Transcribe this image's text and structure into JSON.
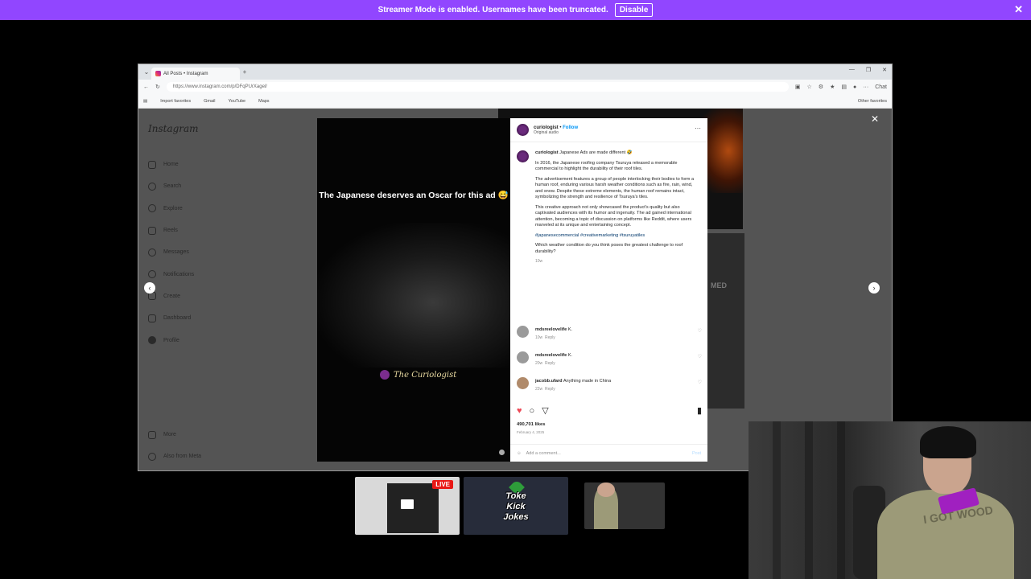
{
  "banner": {
    "message": "Streamer Mode is enabled. Usernames have been truncated.",
    "disable_label": "Disable",
    "close_glyph": "✕"
  },
  "browser": {
    "tab_title": "All Posts • Instagram",
    "new_tab_glyph": "+",
    "url": "https://www.instagram.com/p/DFqPUrXagel/",
    "copilot_label": "Chat",
    "window_controls": [
      "—",
      "❐",
      "✕"
    ],
    "favorites": [
      "Import favorites",
      "Gmail",
      "YouTube",
      "Maps"
    ],
    "other_favorites": "Other favorites"
  },
  "instagram": {
    "logo": "Instagram",
    "nav": [
      "Home",
      "Search",
      "Explore",
      "Reels",
      "Messages",
      "Notifications",
      "Create",
      "Dashboard",
      "Profile"
    ],
    "nav_bottom": [
      "More",
      "Also from Meta"
    ],
    "bg_text": "MED",
    "close_glyph": "✕",
    "prev_glyph": "‹",
    "next_glyph": "›"
  },
  "post": {
    "video_caption": "The Japanese deserves an Oscar for this ad 😅",
    "video_brand": "The Curiologist",
    "username": "curiologist",
    "follow_label": "Follow",
    "dot": "•",
    "audio": "Original audio",
    "more_glyph": "···",
    "caption_user": "curiologist",
    "caption_head": "Japanese Ads are made different 🤣",
    "paragraphs": [
      "In 2016, the Japanese roofing company Tsuruya released a memorable commercial to highlight the durability of their roof tiles.",
      "The advertisement features a group of people interlocking their bodies to form a human roof, enduring various harsh weather conditions such as fire, rain, wind, and snow. Despite these extreme elements, the human roof remains intact, symbolizing the strength and resilience of Tsuruya's tiles.",
      "This creative approach not only showcased the product's quality but also captivated audiences with its humor and ingenuity. The ad gained international attention, becoming a topic of discussion on platforms like Reddit, where users marveled at its unique and entertaining concept."
    ],
    "hashtags": "#japanesecommercial #creativemarketing #tsuruyatiles",
    "question": "Which weather condition do you think poses the greatest challenge to roof durability?",
    "caption_age": "10w",
    "comments": [
      {
        "user": "mdsreelovelife",
        "text": "K.",
        "age": "10w",
        "reply": "Reply"
      },
      {
        "user": "mdsreelovelife",
        "text": "K.",
        "age": "20w",
        "reply": "Reply"
      },
      {
        "user": "jacobb.ufard",
        "text": "Anything made in China",
        "age": "22w",
        "reply": "Reply"
      }
    ],
    "likes": "490,701 likes",
    "date": "February 4, 2025",
    "add_comment_placeholder": "Add a comment...",
    "post_label": "Post"
  },
  "stream": {
    "live_label": "LIVE",
    "scene2_lines": [
      "Toke",
      "Kick",
      "Jokes"
    ],
    "shirt_text": "I GOT WOOD"
  }
}
